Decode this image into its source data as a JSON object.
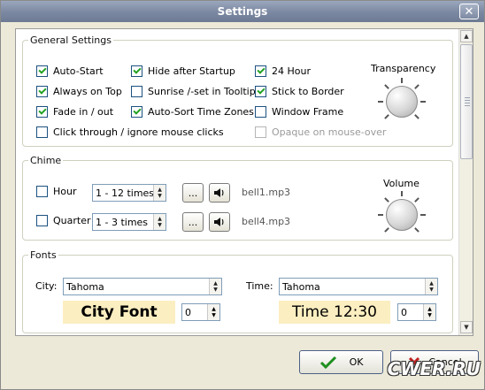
{
  "window": {
    "title": "Settings",
    "close_glyph": "✕"
  },
  "general": {
    "legend": "General Settings",
    "options": [
      {
        "label": "Auto-Start",
        "checked": true,
        "enabled": true
      },
      {
        "label": "Always on Top",
        "checked": true,
        "enabled": true
      },
      {
        "label": "Fade in / out",
        "checked": true,
        "enabled": true
      },
      {
        "label": "Click through / ignore mouse clicks",
        "checked": false,
        "enabled": true
      },
      {
        "label": "Hide after Startup",
        "checked": true,
        "enabled": true
      },
      {
        "label": "Sunrise /-set in Tooltip",
        "checked": false,
        "enabled": true
      },
      {
        "label": "Auto-Sort Time Zones",
        "checked": true,
        "enabled": true
      },
      {
        "label": "24 Hour",
        "checked": true,
        "enabled": true
      },
      {
        "label": "Stick to Border",
        "checked": true,
        "enabled": true
      },
      {
        "label": "Window Frame",
        "checked": false,
        "enabled": true
      },
      {
        "label": "Opaque on mouse-over",
        "checked": false,
        "enabled": false
      }
    ],
    "transparency_label": "Transparency"
  },
  "chime": {
    "legend": "Chime",
    "hour": {
      "label": "Hour",
      "checked": false,
      "interval": "1 - 12 times",
      "browse": "...",
      "file": "bell1.mp3"
    },
    "quarter": {
      "label": "Quarter",
      "checked": false,
      "interval": "1 - 3 times",
      "browse": "...",
      "file": "bell4.mp3"
    },
    "volume_label": "Volume"
  },
  "fonts": {
    "legend": "Fonts",
    "city_label": "City:",
    "city_font": "Tahoma",
    "city_preview": "City Font",
    "city_size": "0",
    "time_label": "Time:",
    "time_font": "Tahoma",
    "time_preview": "Time 12:30",
    "time_size": "0"
  },
  "buttons": {
    "ok": "OK",
    "cancel": "Cancel"
  },
  "watermark": "CWER.RU",
  "colors": {
    "preview_bg": "#fbeec0",
    "check": "#21a121",
    "title_bar": "#7d8aa3"
  }
}
